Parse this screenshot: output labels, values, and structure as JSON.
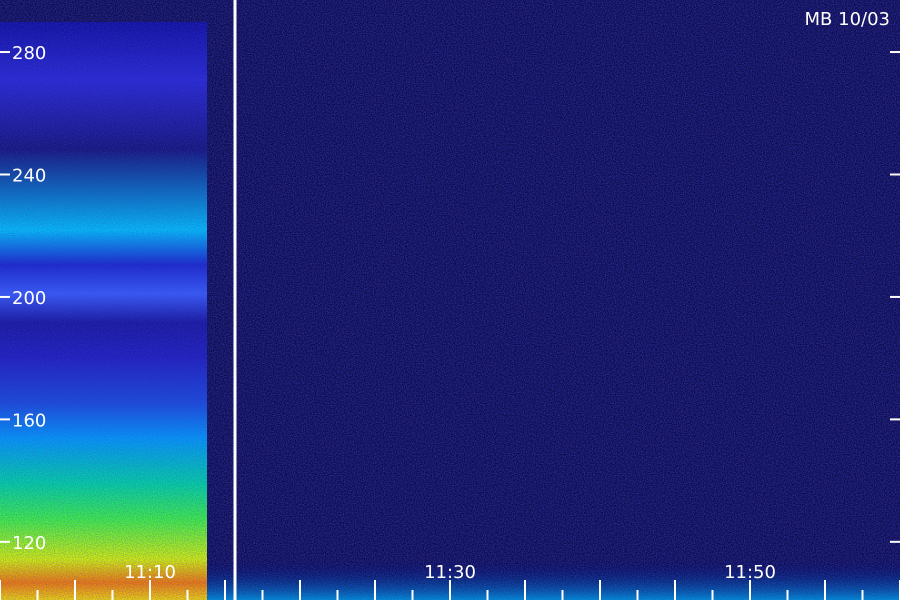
{
  "chart_data": {
    "type": "heatmap",
    "title": "MB 10/03",
    "xlabel": "",
    "ylabel": "",
    "y_ticks": [
      {
        "value": 280,
        "label": "280"
      },
      {
        "value": 240,
        "label": "240"
      },
      {
        "value": 200,
        "label": "200"
      },
      {
        "value": 160,
        "label": "160"
      },
      {
        "value": 120,
        "label": "120"
      }
    ],
    "ylim": [
      101,
      297
    ],
    "x_labels": [
      {
        "label": "11:10"
      },
      {
        "label": "11:30"
      },
      {
        "label": "11:50"
      }
    ],
    "x_range_minutes": [
      "11:00",
      "12:00"
    ],
    "event_marker_time": "11:15",
    "colormap": [
      "#00007a",
      "#1a1ae6",
      "#00bfff",
      "#00ff80",
      "#ffff00",
      "#ff4000"
    ],
    "background": "#0a0a40",
    "foreground": "#ffffff"
  }
}
